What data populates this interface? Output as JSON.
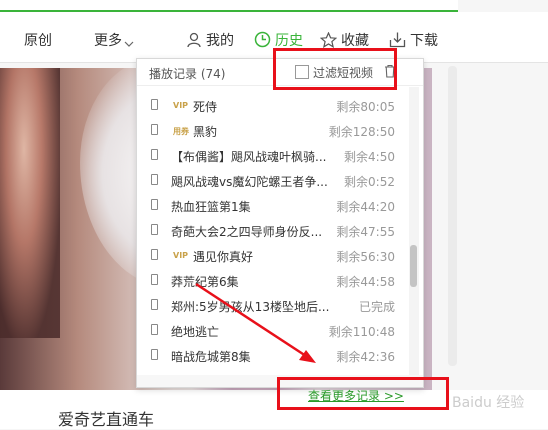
{
  "nav": {
    "items": [
      {
        "label": "原创"
      },
      {
        "label": "更多",
        "icon": "chevron-down-icon"
      },
      {
        "label": "我的",
        "icon": "user-icon"
      },
      {
        "label": "历史",
        "icon": "clock-icon"
      },
      {
        "label": "收藏",
        "icon": "star-icon"
      },
      {
        "label": "下载",
        "icon": "download-icon"
      }
    ]
  },
  "dropdown": {
    "title": "播放记录 (74)",
    "filter_label": "过滤短视频",
    "filter_checked": false,
    "more_link": "查看更多记录 >>",
    "items": [
      {
        "tag": "VIP",
        "name": "死侍",
        "remain": "剩余80:05"
      },
      {
        "tag": "用券",
        "name": "黑豹",
        "remain": "剩余128:50"
      },
      {
        "tag": "",
        "name": "【布偶酱】飓风战魂叶枫骑...",
        "remain": "剩余4:50"
      },
      {
        "tag": "",
        "name": "飓风战魂vs魔幻陀螺王者争...",
        "remain": "剩余0:52"
      },
      {
        "tag": "",
        "name": "热血狂篮第1集",
        "remain": "剩余44:20"
      },
      {
        "tag": "",
        "name": "奇葩大会2之四导师身份反...",
        "remain": "剩余47:55"
      },
      {
        "tag": "VIP",
        "name": "遇见你真好",
        "remain": "剩余56:30"
      },
      {
        "tag": "",
        "name": "莽荒纪第6集",
        "remain": "剩余44:58"
      },
      {
        "tag": "",
        "name": "郑州:5岁男孩从13楼坠地后...",
        "remain": "已完成"
      },
      {
        "tag": "",
        "name": "绝地逃亡",
        "remain": "剩余110:48"
      },
      {
        "tag": "",
        "name": "暗战危城第8集",
        "remain": "剩余42:36"
      }
    ]
  },
  "footer": {
    "title": "爱奇艺直通车"
  },
  "watermark": "Baidu 经验",
  "colors": {
    "accent": "#3ab43a",
    "highlight": "#e8101a",
    "link": "#2a9a2a"
  }
}
